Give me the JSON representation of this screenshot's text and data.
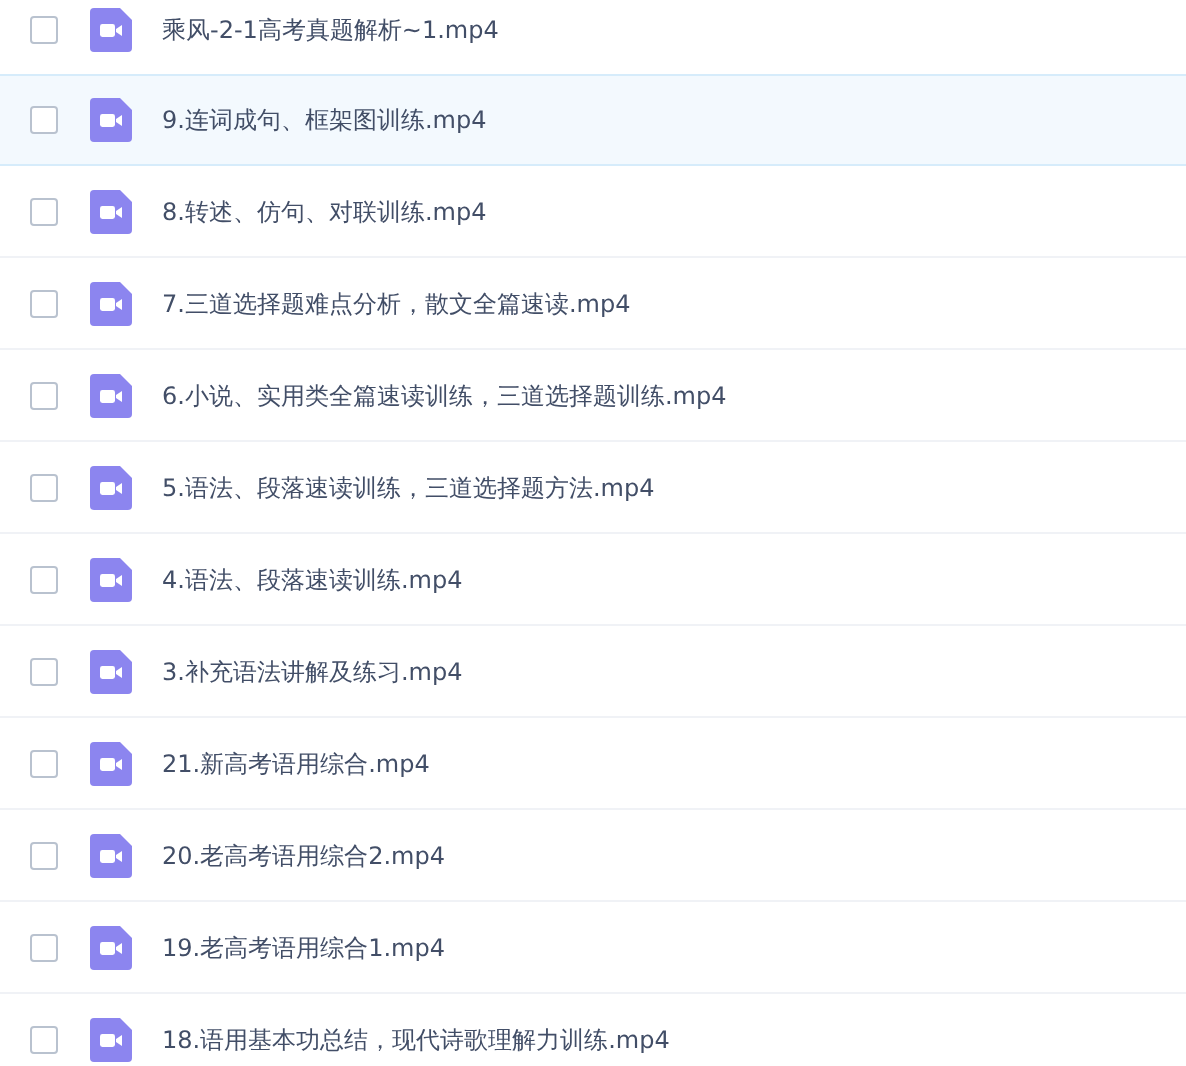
{
  "files": [
    {
      "name": "乘风-2-1高考真题解析~1.mp4",
      "checked": false,
      "highlighted": false
    },
    {
      "name": "9.连词成句、框架图训练.mp4",
      "checked": false,
      "highlighted": true
    },
    {
      "name": "8.转述、仿句、对联训练.mp4",
      "checked": false,
      "highlighted": false
    },
    {
      "name": "7.三道选择题难点分析，散文全篇速读.mp4",
      "checked": false,
      "highlighted": false
    },
    {
      "name": "6.小说、实用类全篇速读训练，三道选择题训练.mp4",
      "checked": false,
      "highlighted": false
    },
    {
      "name": "5.语法、段落速读训练，三道选择题方法.mp4",
      "checked": false,
      "highlighted": false
    },
    {
      "name": "4.语法、段落速读训练.mp4",
      "checked": false,
      "highlighted": false
    },
    {
      "name": "3.补充语法讲解及练习.mp4",
      "checked": false,
      "highlighted": false
    },
    {
      "name": "21.新高考语用综合.mp4",
      "checked": false,
      "highlighted": false
    },
    {
      "name": "20.老高考语用综合2.mp4",
      "checked": false,
      "highlighted": false
    },
    {
      "name": "19.老高考语用综合1.mp4",
      "checked": false,
      "highlighted": false
    },
    {
      "name": "18.语用基本功总结，现代诗歌理解力训练.mp4",
      "checked": false,
      "highlighted": false
    }
  ]
}
